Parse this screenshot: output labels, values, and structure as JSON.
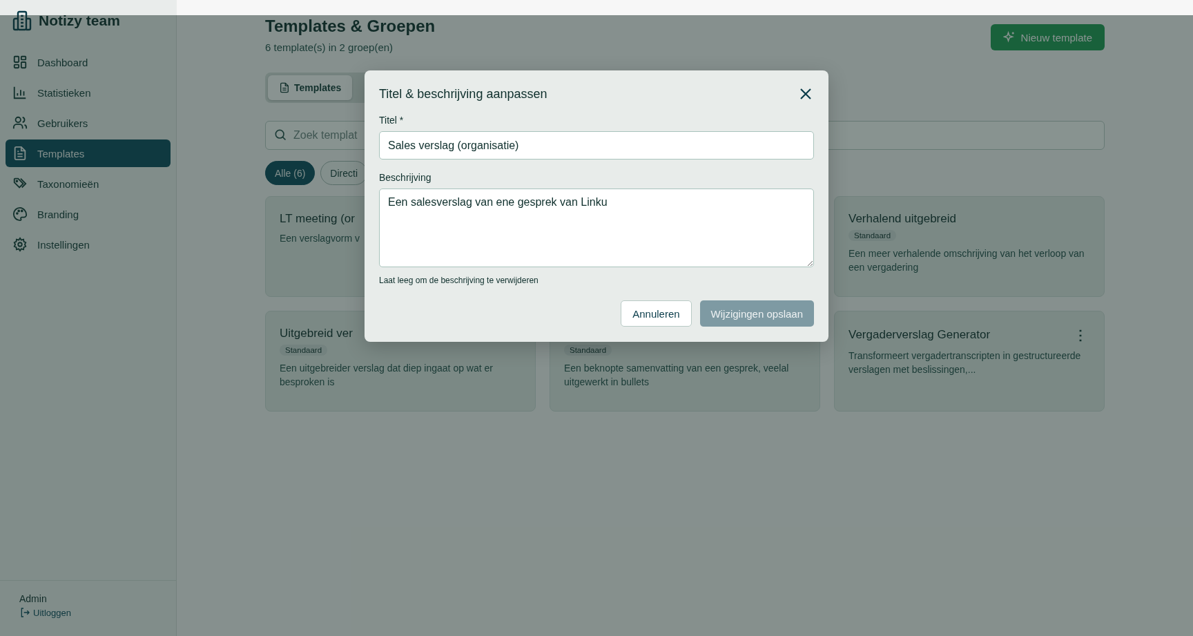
{
  "sidebar": {
    "brand": "Notizy team",
    "items": [
      {
        "label": "Dashboard",
        "selected": false
      },
      {
        "label": "Statistieken",
        "selected": false
      },
      {
        "label": "Gebruikers",
        "selected": false
      },
      {
        "label": "Templates",
        "selected": true
      },
      {
        "label": "Taxonomieën",
        "selected": false
      },
      {
        "label": "Branding",
        "selected": false
      },
      {
        "label": "Instellingen",
        "selected": false
      }
    ],
    "user": "Admin",
    "logout": "Uitloggen"
  },
  "header": {
    "title": "Templates & Groepen",
    "subtitle": "6 template(s) in 2 groep(en)",
    "new_button": "Nieuw template"
  },
  "tabs": [
    {
      "label": "Templates",
      "selected": true
    }
  ],
  "search": {
    "placeholder": "Zoek templat"
  },
  "filters": [
    {
      "label": "Alle (6)",
      "selected": true
    },
    {
      "label": "Directi",
      "selected": false
    }
  ],
  "card_rows": [
    [
      {
        "title": "LT meeting (or",
        "description": "Een verslagvorm v"
      },
      null,
      {
        "title": "Verhalend uitgebreid",
        "badge": "Standaard",
        "description": "Een meer verhalende omschrijving van het verloop van een vergadering"
      }
    ],
    [
      {
        "title": "Uitgebreid ver",
        "badge": "Standaard",
        "description": "Een uitgebreider verslag dat diep ingaat op wat er besproken is"
      },
      {
        "badge": "Standaard",
        "description": "Een beknopte samenvatting van een gesprek, veelal uitgewerkt in bullets"
      },
      {
        "title": "Vergaderverslag Generator",
        "menu": "⋮",
        "description": "Transformeert vergadertranscripten in gestructureerde verslagen met beslissingen,..."
      }
    ]
  ],
  "dialog": {
    "title": "Titel & beschrijving aanpassen",
    "title_label": "Titel *",
    "title_value": "Sales verslag (organisatie)",
    "description_label": "Beschrijving",
    "description_value": "Een salesverslag van ene gesprek van Linku",
    "hint": "Laat leeg om de beschrijving te verwijderen",
    "cancel": "Annuleren",
    "save": "Wijzigingen opslaan",
    "save_disabled": true
  }
}
